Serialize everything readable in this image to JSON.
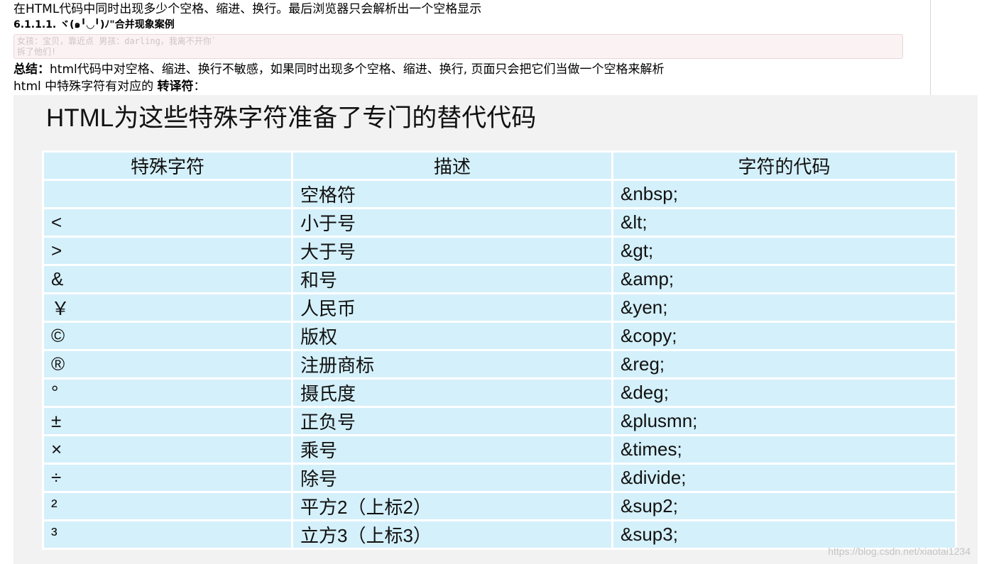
{
  "intro": "在HTML代码中同时出现多少个空格、缩进、换行。最后浏览器只会解析出一个空格显示",
  "section_heading": "6.1.1.1. ヾ(๑╹◡╹)ﾉ\"合并现象案例",
  "code_lines": [
    "女孩：宝贝，靠近点 男孩：darling，我离不开你`",
    "拆了他们!"
  ],
  "summary": {
    "label": "总结：",
    "text": "html代码中对空格、缩进、换行不敏感，如果同时出现多个空格、缩进、换行, 页面只会把它们当做一个空格来解析"
  },
  "escape_line": {
    "prefix": "html 中特殊字符有对应的 ",
    "bold": "转译符",
    "suffix": "："
  },
  "figure": {
    "title": "HTML为这些特殊字符准备了专门的替代代码",
    "headers": [
      "特殊字符",
      "描述",
      "字符的代码"
    ],
    "rows": [
      [
        "",
        "空格符",
        "&nbsp;"
      ],
      [
        "<",
        "小于号",
        "&lt;"
      ],
      [
        ">",
        "大于号",
        "&gt;"
      ],
      [
        "&",
        "和号",
        "&amp;"
      ],
      [
        "￥",
        "人民币",
        "&yen;"
      ],
      [
        "©",
        "版权",
        "&copy;"
      ],
      [
        "®",
        "注册商标",
        "&reg;"
      ],
      [
        "°",
        "摄氏度",
        "&deg;"
      ],
      [
        "±",
        "正负号",
        "&plusmn;"
      ],
      [
        "×",
        "乘号",
        "&times;"
      ],
      [
        "÷",
        "除号",
        "&divide;"
      ],
      [
        "²",
        "平方2（上标2）",
        "&sup2;"
      ],
      [
        "³",
        "立方3（上标3）",
        "&sup3;"
      ]
    ],
    "watermark": "https://blog.csdn.net/xiaotai1234"
  },
  "colors": {
    "table_cell_bg": "#d4f0fa",
    "figure_bg": "#f2f2f2",
    "code_bg": "#fbf2f3"
  }
}
